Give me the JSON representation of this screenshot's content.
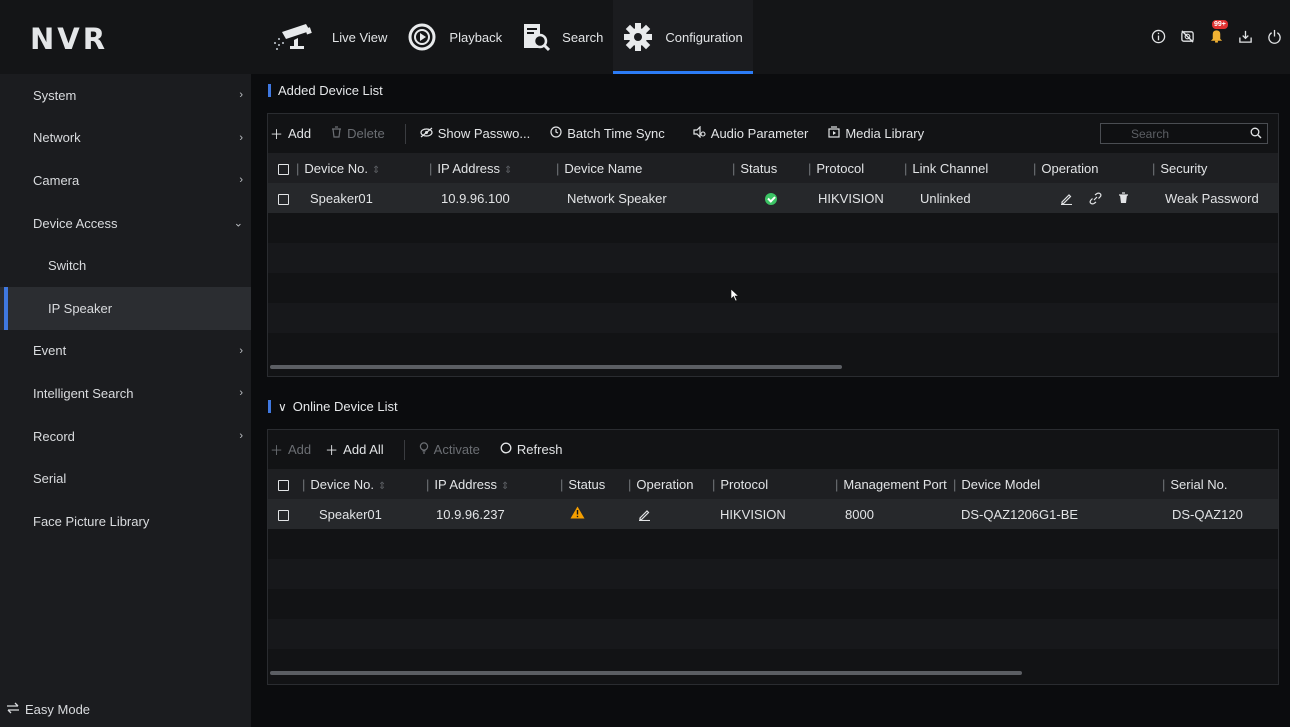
{
  "app": {
    "logo": "NVR"
  },
  "nav": [
    {
      "label": "Live View",
      "icon": "camera-icon"
    },
    {
      "label": "Playback",
      "icon": "playback-icon"
    },
    {
      "label": "Search",
      "icon": "search-file-icon"
    },
    {
      "label": "Configuration",
      "icon": "gear-icon",
      "active": true
    }
  ],
  "top_badge": "99+",
  "sidebar": {
    "items": [
      {
        "label": "System",
        "arrow": "›"
      },
      {
        "label": "Network",
        "arrow": "›"
      },
      {
        "label": "Camera",
        "arrow": "›"
      },
      {
        "label": "Device Access",
        "arrow": "⌄"
      },
      {
        "label": "Switch"
      },
      {
        "label": "IP Speaker",
        "active": true
      },
      {
        "label": "Event",
        "arrow": "›"
      },
      {
        "label": "Intelligent Search",
        "arrow": "›"
      },
      {
        "label": "Record",
        "arrow": "›"
      },
      {
        "label": "Serial"
      },
      {
        "label": "Face Picture Library"
      }
    ],
    "easy_mode": "Easy Mode"
  },
  "added": {
    "title": "Added Device List",
    "toolbar": {
      "add": "Add",
      "delete": "Delete",
      "show_password": "Show Passwo...",
      "batch_time_sync": "Batch Time Sync",
      "audio_parameter": "Audio Parameter",
      "media_library": "Media Library",
      "search_placeholder": "Search"
    },
    "columns": [
      "Device No.",
      "IP Address",
      "Device Name",
      "Status",
      "Protocol",
      "Link Channel",
      "Operation",
      "Security"
    ],
    "rows": [
      {
        "device_no": "Speaker01",
        "ip": "10.9.96.100",
        "name": "Network Speaker",
        "status": "online",
        "protocol": "HIKVISION",
        "link_channel": "Unlinked",
        "security": "Weak Password"
      }
    ]
  },
  "online": {
    "title": "Online Device List",
    "toolbar": {
      "add": "Add",
      "add_all": "Add All",
      "activate": "Activate",
      "refresh": "Refresh"
    },
    "columns": [
      "Device No.",
      "IP Address",
      "Status",
      "Operation",
      "Protocol",
      "Management Port",
      "Device Model",
      "Serial No."
    ],
    "rows": [
      {
        "device_no": "Speaker01",
        "ip": "10.9.96.237",
        "status": "warning",
        "protocol": "HIKVISION",
        "port": "8000",
        "model": "DS-QAZ1206G1-BE",
        "serial": "DS-QAZ120"
      }
    ]
  },
  "colors": {
    "accent": "#2c7cf6",
    "ok": "#3cc465",
    "warn": "#f59f00"
  }
}
